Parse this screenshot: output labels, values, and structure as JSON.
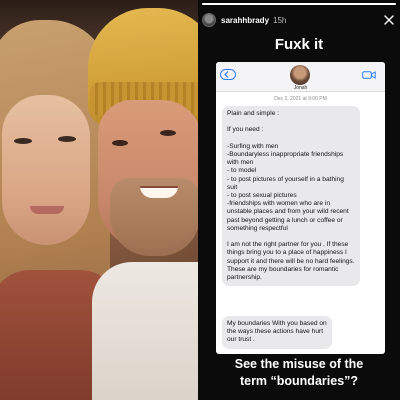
{
  "story": {
    "username": "sarahhbrady",
    "time": "15h",
    "title": "Fuxk it",
    "progress": 1.0,
    "caption_line1": "See the misuse of the",
    "caption_line2": "term “boundaries”?"
  },
  "message_screenshot": {
    "back_label": "",
    "contact_name": "Jonah",
    "date": "Dec 2, 2021 at 9:00 PM",
    "bubble_main": "Plain and simple :\n\nIf you need :\n\n-Surfing with men\n-Boundaryless inappropriate friendships with men\n- to model\n- to post pictures of yourself in a bathing suit\n- to post sexual pictures\n-friendships with women who are in unstable places and from your wild recent past beyond getting a lunch or coffee or something respectful\n\nI am not the right partner for you . If these things bring you to a place of happiness I support it and there will be no hard feelings. These are my boundaries for romantic partnership.",
    "bubble_second": "My boundaries With you based on the ways these actions have hurt our trust ."
  },
  "colors": {
    "accent_blue": "#2d7cf6",
    "bubble_gray": "#e9e9eb",
    "story_bg": "#0b0b0b"
  },
  "icons": [
    "close-icon",
    "video-camera-icon",
    "back-chevron-icon"
  ]
}
